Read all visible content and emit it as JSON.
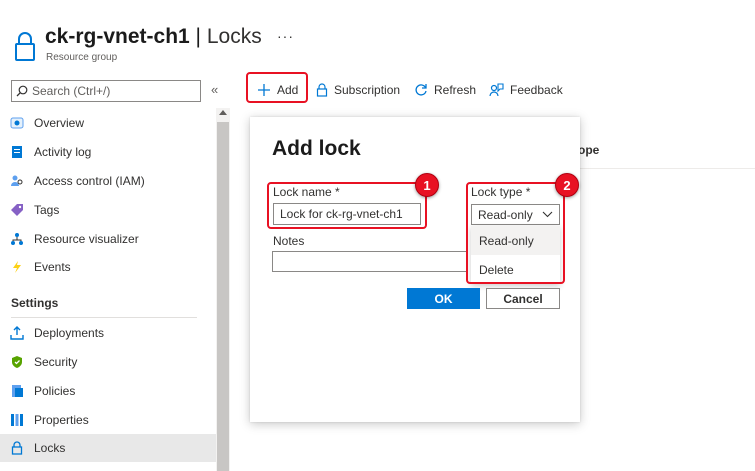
{
  "header": {
    "resource_name": "ck-rg-vnet-ch1",
    "separator": "|",
    "page_title": "Locks",
    "subtitle": "Resource group",
    "more": "···"
  },
  "sidebar": {
    "search_placeholder": "Search (Ctrl+/)",
    "collapse": "«",
    "items": [
      {
        "label": "Overview",
        "icon": "overview-icon"
      },
      {
        "label": "Activity log",
        "icon": "activity-log-icon"
      },
      {
        "label": "Access control (IAM)",
        "icon": "iam-icon"
      },
      {
        "label": "Tags",
        "icon": "tag-icon"
      },
      {
        "label": "Resource visualizer",
        "icon": "visualizer-icon"
      },
      {
        "label": "Events",
        "icon": "lightning-icon"
      }
    ],
    "settings_header": "Settings",
    "settings_items": [
      {
        "label": "Deployments",
        "icon": "deploy-icon"
      },
      {
        "label": "Security",
        "icon": "shield-icon"
      },
      {
        "label": "Policies",
        "icon": "policy-icon"
      },
      {
        "label": "Properties",
        "icon": "properties-icon"
      },
      {
        "label": "Locks",
        "icon": "lock-icon",
        "active": true
      }
    ]
  },
  "toolbar": {
    "add": "Add",
    "subscription": "Subscription",
    "refresh": "Refresh",
    "feedback": "Feedback"
  },
  "table": {
    "scope_header_partial": "ope"
  },
  "dialog": {
    "title": "Add lock",
    "lock_name_label": "Lock name *",
    "lock_name_value": "Lock for ck-rg-vnet-ch1",
    "lock_type_label": "Lock type *",
    "lock_type_value": "Read-only",
    "lock_type_options": [
      "Read-only",
      "Delete"
    ],
    "notes_label": "Notes",
    "notes_value": "",
    "ok": "OK",
    "cancel": "Cancel"
  },
  "callouts": {
    "one": "1",
    "two": "2"
  },
  "colors": {
    "accent": "#0078d4",
    "callout": "#e81123"
  }
}
